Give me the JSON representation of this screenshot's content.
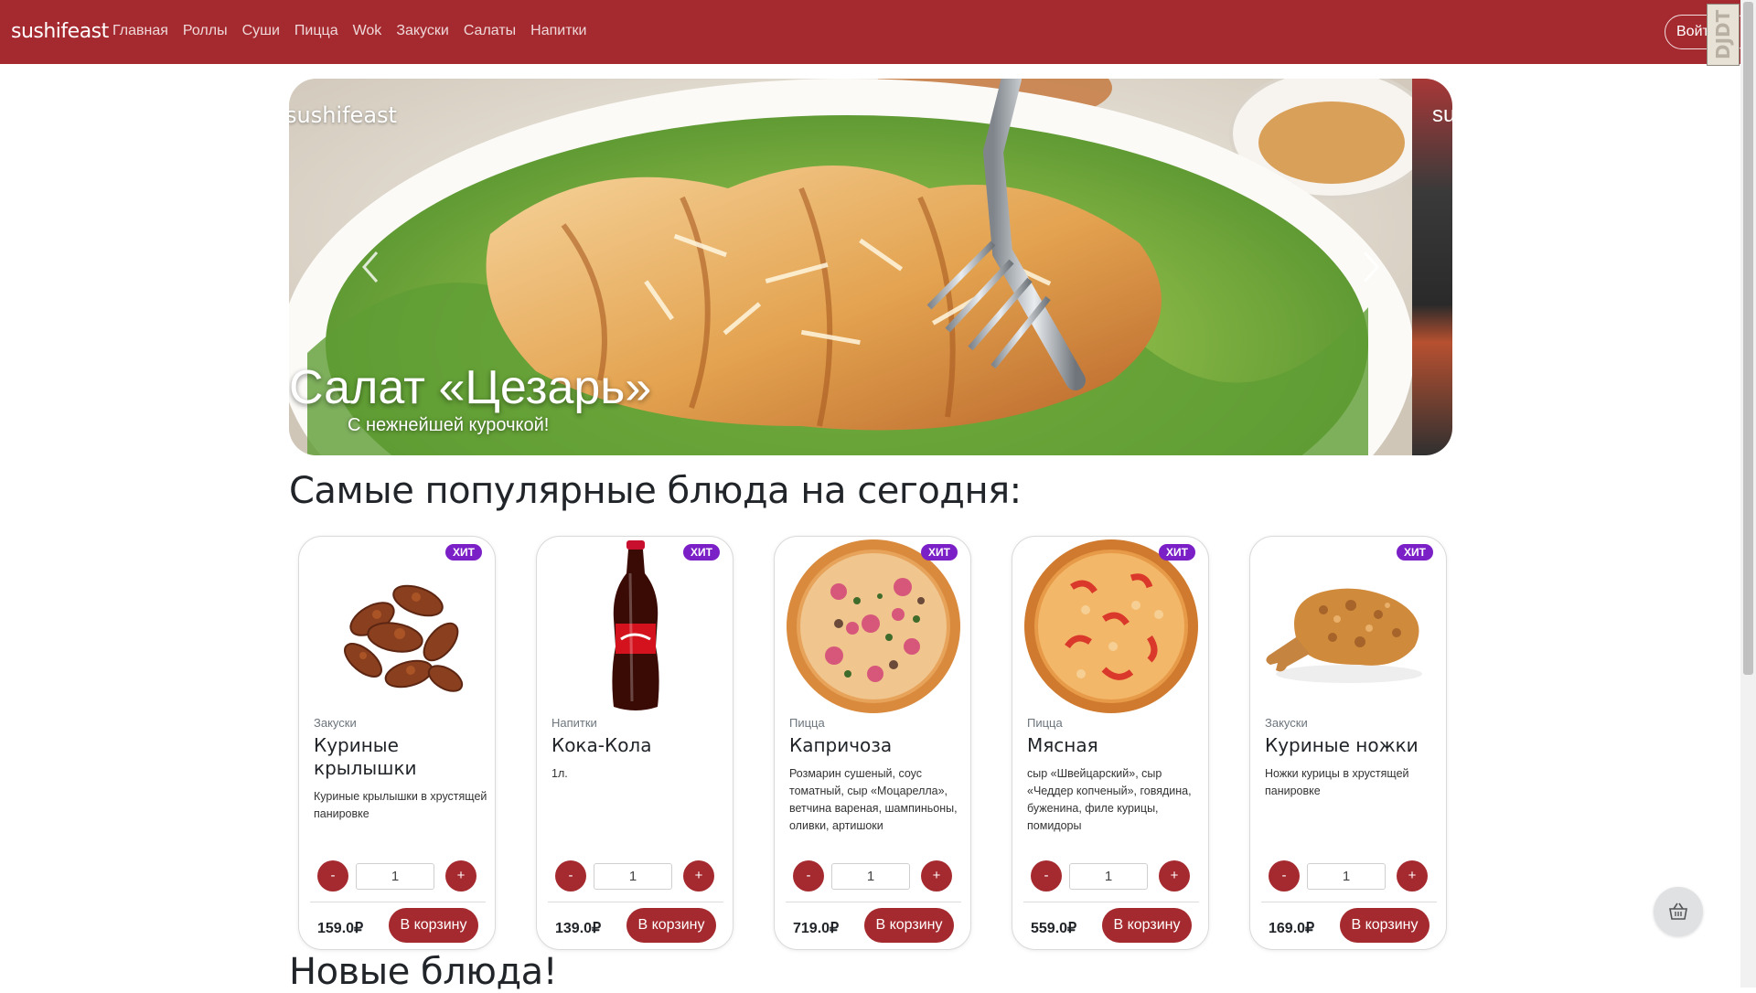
{
  "navbar": {
    "brand": "sushifeast",
    "links": [
      "Главная",
      "Роллы",
      "Суши",
      "Пицца",
      "Wok",
      "Закуски",
      "Салаты",
      "Напитки"
    ],
    "login_label": "Войти",
    "extension_label": "DJDT"
  },
  "carousel": {
    "brand": "sushifeast",
    "next_brand": "su",
    "title": "Салат «Цезарь»",
    "subtitle": "С нежнейшей курочкой!"
  },
  "sections": {
    "popular": "Самые популярные блюда на сегодня:",
    "new": "Новые блюда!"
  },
  "cards": [
    {
      "badge": "ХИТ",
      "category": "Закуски",
      "title": "Куриные крылышки",
      "description": "Куриные крылышки в хрустящей панировке",
      "qty": "1",
      "price": "159.0₽",
      "cart_label": "В корзину",
      "minus": "-",
      "plus": "+"
    },
    {
      "badge": "ХИТ",
      "category": "Напитки",
      "title": "Кока-Кола",
      "description": "1л.",
      "qty": "1",
      "price": "139.0₽",
      "cart_label": "В корзину",
      "minus": "-",
      "plus": "+"
    },
    {
      "badge": "ХИТ",
      "category": "Пицца",
      "title": "Капричоза",
      "description": "Розмарин сушеный, соус томатный, сыр «Моцарелла», ветчина вареная, шампиньоны, оливки, артишоки",
      "qty": "1",
      "price": "719.0₽",
      "cart_label": "В корзину",
      "minus": "-",
      "plus": "+"
    },
    {
      "badge": "ХИТ",
      "category": "Пицца",
      "title": "Мясная",
      "description": "сыр «Швейцарский», сыр «Чеддер копченый», говядина, буженина, филе курицы, помидоры",
      "qty": "1",
      "price": "559.0₽",
      "cart_label": "В корзину",
      "minus": "-",
      "plus": "+"
    },
    {
      "badge": "ХИТ",
      "category": "Закуски",
      "title": "Куриные ножки",
      "description": "Ножки курицы в хрустящей панировке",
      "qty": "1",
      "price": "169.0₽",
      "cart_label": "В корзину",
      "minus": "-",
      "plus": "+"
    }
  ],
  "colors": {
    "brand_red": "#a52a2f",
    "badge_purple": "#7b1fc7"
  }
}
